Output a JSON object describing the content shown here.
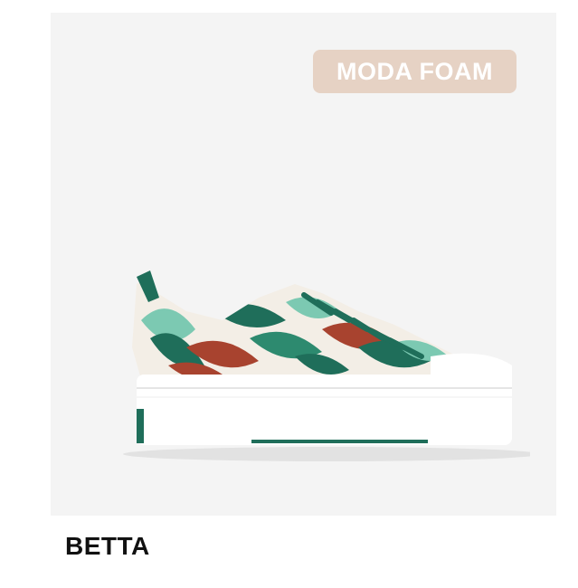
{
  "product": {
    "badge_label": "MODA FOAM",
    "name": "BETTA",
    "image_icon": "sneaker-image"
  },
  "colors": {
    "panel_bg": "#f4f4f4",
    "badge_bg": "#e6d2c4",
    "sole": "#ffffff",
    "leaf_green": "#1f6e5a",
    "mint": "#7cc9b2",
    "rust": "#a8432f",
    "cream": "#f3eee6",
    "text": "#111111"
  }
}
